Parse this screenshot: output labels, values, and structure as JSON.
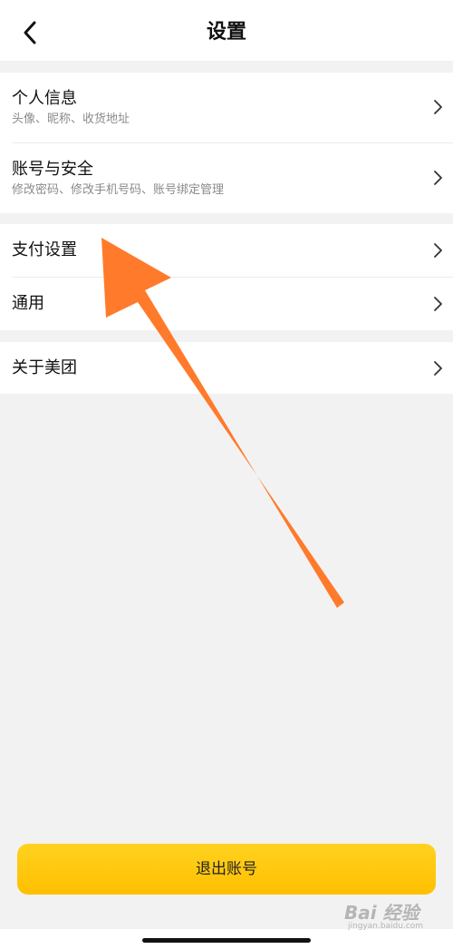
{
  "header": {
    "title": "设置"
  },
  "groups": [
    {
      "items": [
        {
          "title": "个人信息",
          "subtitle": "头像、昵称、收货地址"
        },
        {
          "title": "账号与安全",
          "subtitle": "修改密码、修改手机号码、账号绑定管理"
        }
      ]
    },
    {
      "items": [
        {
          "title": "支付设置"
        },
        {
          "title": "通用"
        }
      ]
    },
    {
      "items": [
        {
          "title": "关于美团"
        }
      ]
    }
  ],
  "logout": {
    "label": "退出账号"
  },
  "watermark": {
    "text": "Bai 经验",
    "sub": "jingyan.baidu.com"
  },
  "colors": {
    "accent": "#ffc300",
    "arrow": "#ff7a2b",
    "background": "#f2f2f2"
  }
}
